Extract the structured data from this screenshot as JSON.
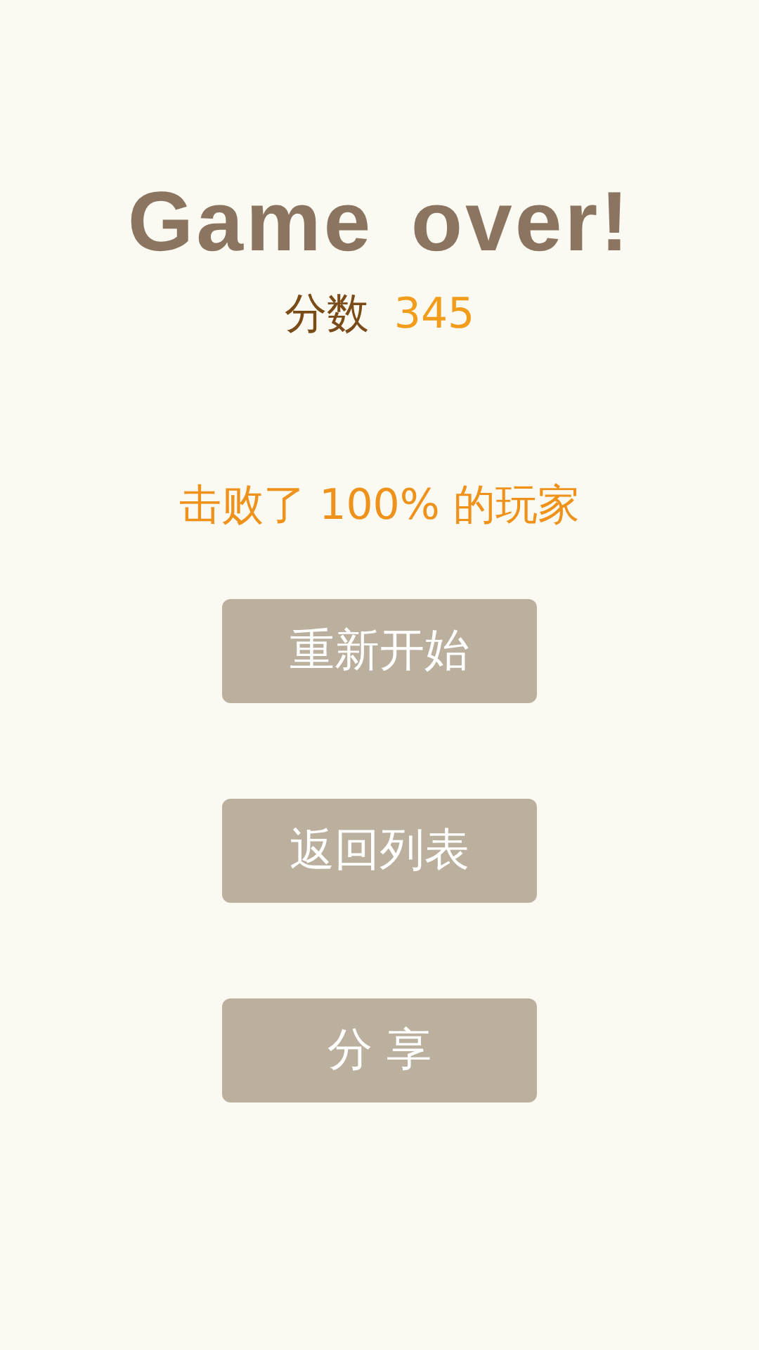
{
  "title": "Game over!",
  "score": {
    "label": "分数",
    "value": "345"
  },
  "result": "击败了 100% 的玩家",
  "buttons": [
    {
      "label": "重新开始"
    },
    {
      "label": "返回列表"
    },
    {
      "label": "分 享"
    }
  ]
}
